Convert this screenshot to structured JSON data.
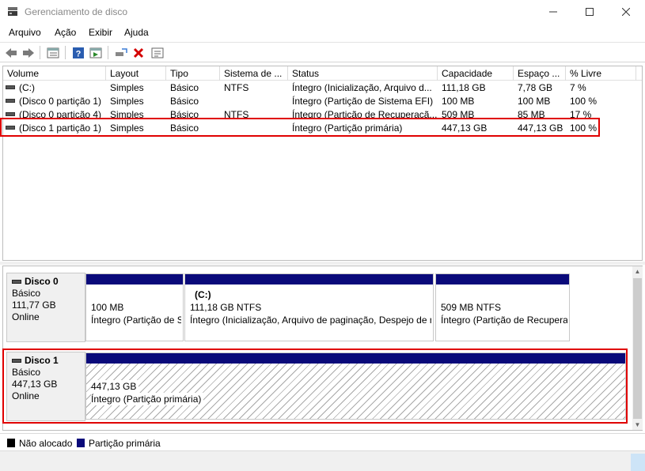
{
  "window": {
    "title": "Gerenciamento de disco",
    "icon": "disk-management-icon"
  },
  "menu": [
    "Arquivo",
    "Ação",
    "Exibir",
    "Ajuda"
  ],
  "toolbar": [
    "back-icon",
    "forward-icon",
    "list-view-icon",
    "help-icon",
    "properties-icon",
    "connect-icon",
    "delete-icon",
    "settings-icon"
  ],
  "volume_list": {
    "columns": [
      "Volume",
      "Layout",
      "Tipo",
      "Sistema de ...",
      "Status",
      "Capacidade",
      "Espaço ...",
      "% Livre"
    ],
    "rows": [
      [
        "(C:)",
        "Simples",
        "Básico",
        "NTFS",
        "Íntegro (Inicialização, Arquivo d...",
        "111,18 GB",
        "7,78 GB",
        "7 %"
      ],
      [
        "(Disco 0 partição 1)",
        "Simples",
        "Básico",
        "",
        "Íntegro (Partição de Sistema EFI)",
        "100 MB",
        "100 MB",
        "100 %"
      ],
      [
        "(Disco 0 partição 4)",
        "Simples",
        "Básico",
        "NTFS",
        "Íntegro (Partição de Recuperaçã...",
        "509 MB",
        "85 MB",
        "17 %"
      ],
      [
        "(Disco 1 partição 1)",
        "Simples",
        "Básico",
        "",
        "Íntegro (Partição primária)",
        "447,13 GB",
        "447,13 GB",
        "100 %"
      ]
    ]
  },
  "disks": [
    {
      "name": "Disco 0",
      "type": "Básico",
      "size": "111,77 GB",
      "status": "Online",
      "partitions": [
        {
          "title": "",
          "size": "100 MB",
          "status": "Íntegro (Partição de Sistema EFI)"
        },
        {
          "title": "(C:)",
          "size": "111,18 GB NTFS",
          "status": "Íntegro (Inicialização, Arquivo de paginação, Despejo de memória)"
        },
        {
          "title": "",
          "size": "509 MB NTFS",
          "status": "Íntegro (Partição de Recuperação)"
        }
      ]
    },
    {
      "name": "Disco 1",
      "type": "Básico",
      "size": "447,13 GB",
      "status": "Online",
      "partitions": [
        {
          "title": "",
          "size": "447,13 GB",
          "status": "Íntegro (Partição primária)"
        }
      ]
    }
  ],
  "legend": [
    {
      "label": "Não alocado",
      "color": "#000000"
    },
    {
      "label": "Partição primária",
      "color": "#0a0a7a"
    }
  ],
  "colors": {
    "highlight": "#e00000",
    "primary_partition": "#0a0a7a"
  }
}
